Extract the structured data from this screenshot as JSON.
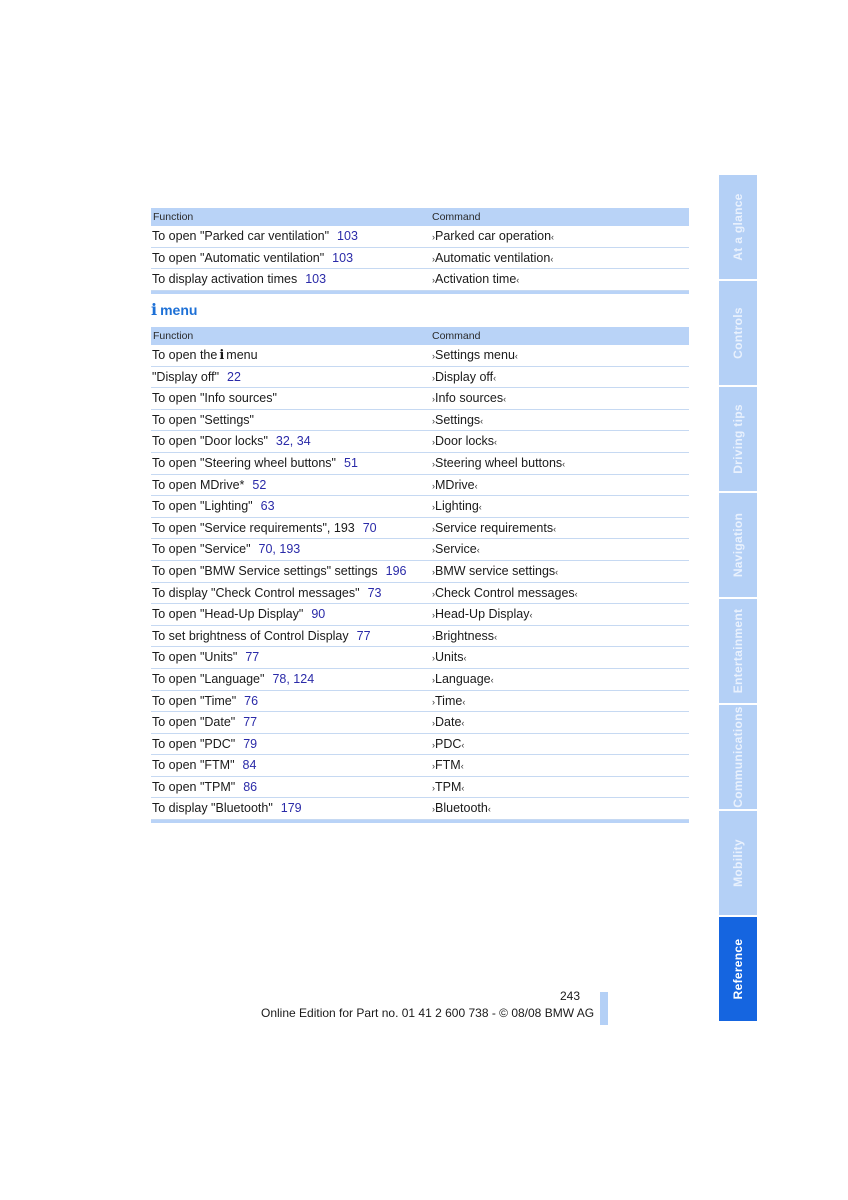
{
  "table1": {
    "header": {
      "function": "Function",
      "command": "Command"
    },
    "rows": [
      {
        "function": "To open \"Parked car ventilation\"",
        "pages": "103",
        "command": "Parked car operation"
      },
      {
        "function": "To open \"Automatic ventilation\"",
        "pages": "103",
        "command": "Automatic ventilation"
      },
      {
        "function": "To display activation times",
        "pages": "103",
        "command": "Activation time"
      }
    ]
  },
  "section": {
    "icon": "i",
    "title": "menu"
  },
  "table2": {
    "header": {
      "function": "Function",
      "command": "Command"
    },
    "rows": [
      {
        "function": "To open the",
        "icon": "i",
        "function_suffix": "menu",
        "pages": "",
        "command": "Settings menu"
      },
      {
        "function": "\"Display off\"",
        "pages": "22",
        "command": "Display off"
      },
      {
        "function": "To open \"Info sources\"",
        "pages": "",
        "command": "Info sources"
      },
      {
        "function": "To open \"Settings\"",
        "pages": "",
        "command": "Settings"
      },
      {
        "function": "To open \"Door locks\"",
        "pages": "32, 34",
        "command": "Door locks"
      },
      {
        "function": "To open \"Steering wheel buttons\"",
        "pages": "51",
        "command": "Steering wheel buttons"
      },
      {
        "function": "To open MDrive*",
        "pages": "52",
        "command": "MDrive"
      },
      {
        "function": "To open \"Lighting\"",
        "pages": "63",
        "command": "Lighting"
      },
      {
        "function": "To open \"Service requirements\", 193",
        "pages": "70",
        "command": "Service requirements"
      },
      {
        "function": "To open \"Service\"",
        "pages": "70, 193",
        "command": "Service"
      },
      {
        "function": "To open \"BMW Service settings\" settings",
        "pages": "196",
        "command": "BMW service settings"
      },
      {
        "function": "To display \"Check Control messages\"",
        "pages": "73",
        "command": "Check Control messages"
      },
      {
        "function": "To open \"Head-Up Display\"",
        "pages": "90",
        "command": "Head-Up Display"
      },
      {
        "function": "To set brightness of Control Display",
        "pages": "77",
        "command": "Brightness"
      },
      {
        "function": "To open \"Units\"",
        "pages": "77",
        "command": "Units"
      },
      {
        "function": "To open \"Language\"",
        "pages": "78, 124",
        "command": "Language"
      },
      {
        "function": "To open \"Time\"",
        "pages": "76",
        "command": "Time"
      },
      {
        "function": "To open \"Date\"",
        "pages": "77",
        "command": "Date"
      },
      {
        "function": "To open \"PDC\"",
        "pages": "79",
        "command": "PDC"
      },
      {
        "function": "To open \"FTM\"",
        "pages": "84",
        "command": "FTM"
      },
      {
        "function": "To open \"TPM\"",
        "pages": "86",
        "command": "TPM"
      },
      {
        "function": "To display \"Bluetooth\"",
        "pages": "179",
        "command": "Bluetooth"
      }
    ]
  },
  "command_marks": {
    "open": "›",
    "close": "‹"
  },
  "side_tabs": [
    {
      "label": "At a glance",
      "active": false
    },
    {
      "label": "Controls",
      "active": false
    },
    {
      "label": "Driving tips",
      "active": false
    },
    {
      "label": "Navigation",
      "active": false
    },
    {
      "label": "Entertainment",
      "active": false
    },
    {
      "label": "Communications",
      "active": false
    },
    {
      "label": "Mobility",
      "active": false
    },
    {
      "label": "Reference",
      "active": true
    }
  ],
  "footer": {
    "page_number": "243",
    "edition": "Online Edition for Part no. 01 41 2 600 738 - © 08/08 BMW AG"
  }
}
